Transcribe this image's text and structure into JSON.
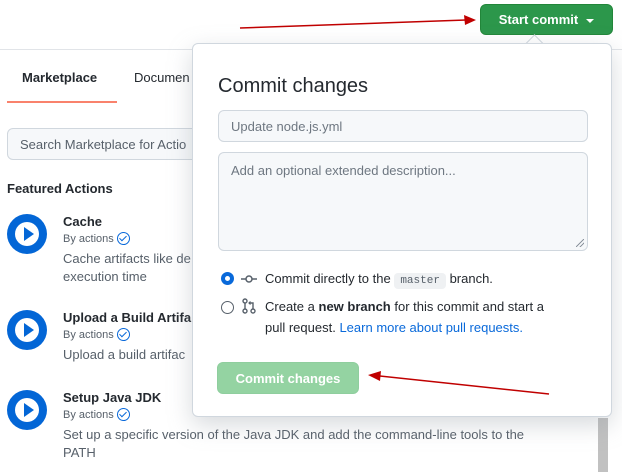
{
  "toolbar": {
    "start_commit_label": "Start commit"
  },
  "sidebar": {
    "tabs": [
      {
        "label": "Marketplace",
        "active": true
      },
      {
        "label": "Documen",
        "active": false
      }
    ],
    "search_placeholder": "Search Marketplace for Actio",
    "featured_heading": "Featured Actions",
    "actions": [
      {
        "title": "Cache",
        "by": "By actions",
        "description": "Cache artifacts like de\nexecution time"
      },
      {
        "title": "Upload a Build Artifa",
        "by": "By actions",
        "description": "Upload a build artifac"
      },
      {
        "title": "Setup Java JDK",
        "by": "By actions",
        "description": "Set up a specific version of the Java JDK and add the command-line tools to the PATH"
      }
    ]
  },
  "popover": {
    "title": "Commit changes",
    "summary_placeholder": "Update node.js.yml",
    "description_placeholder": "Add an optional extended description...",
    "options": {
      "direct": {
        "prefix": "Commit directly to the",
        "branch": "master",
        "suffix": "branch.",
        "selected": true
      },
      "new_branch": {
        "prefix": "Create a",
        "bold": "new branch",
        "suffix": "for this commit and start a",
        "line2": "pull request.",
        "link": "Learn more about pull requests.",
        "selected": false
      }
    },
    "commit_button_label": "Commit changes"
  },
  "colors": {
    "primary_green": "#2c974b",
    "disabled_green": "#94d3a2",
    "link_blue": "#0969da",
    "annotation_red": "#c00000"
  }
}
